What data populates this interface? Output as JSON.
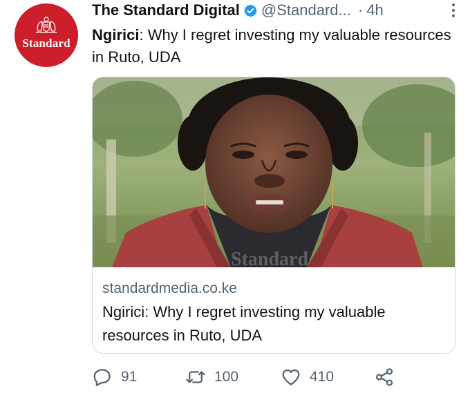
{
  "tweet": {
    "author_name": "The Standard Digital",
    "handle": "@Standard...",
    "separator": "·",
    "time": "4h",
    "avatar_text": "Standard",
    "text_lead": "Ngirici",
    "text_rest": ": Why I regret investing my valuable resources in Ruto, UDA",
    "colors": {
      "avatar_red": "#cc1f2b",
      "verified_blue": "#1d9bf0",
      "muted": "#536471"
    }
  },
  "card": {
    "domain": "standardmedia.co.ke",
    "title": "Ngirici: Why I regret investing my valuable resources in Ruto, UDA",
    "image_watermark": "Standard"
  },
  "actions": {
    "replies": "91",
    "retweets": "100",
    "likes": "410"
  },
  "icons": [
    "verified-badge-icon",
    "more-options-icon",
    "reply-icon",
    "retweet-icon",
    "like-icon",
    "share-icon"
  ]
}
